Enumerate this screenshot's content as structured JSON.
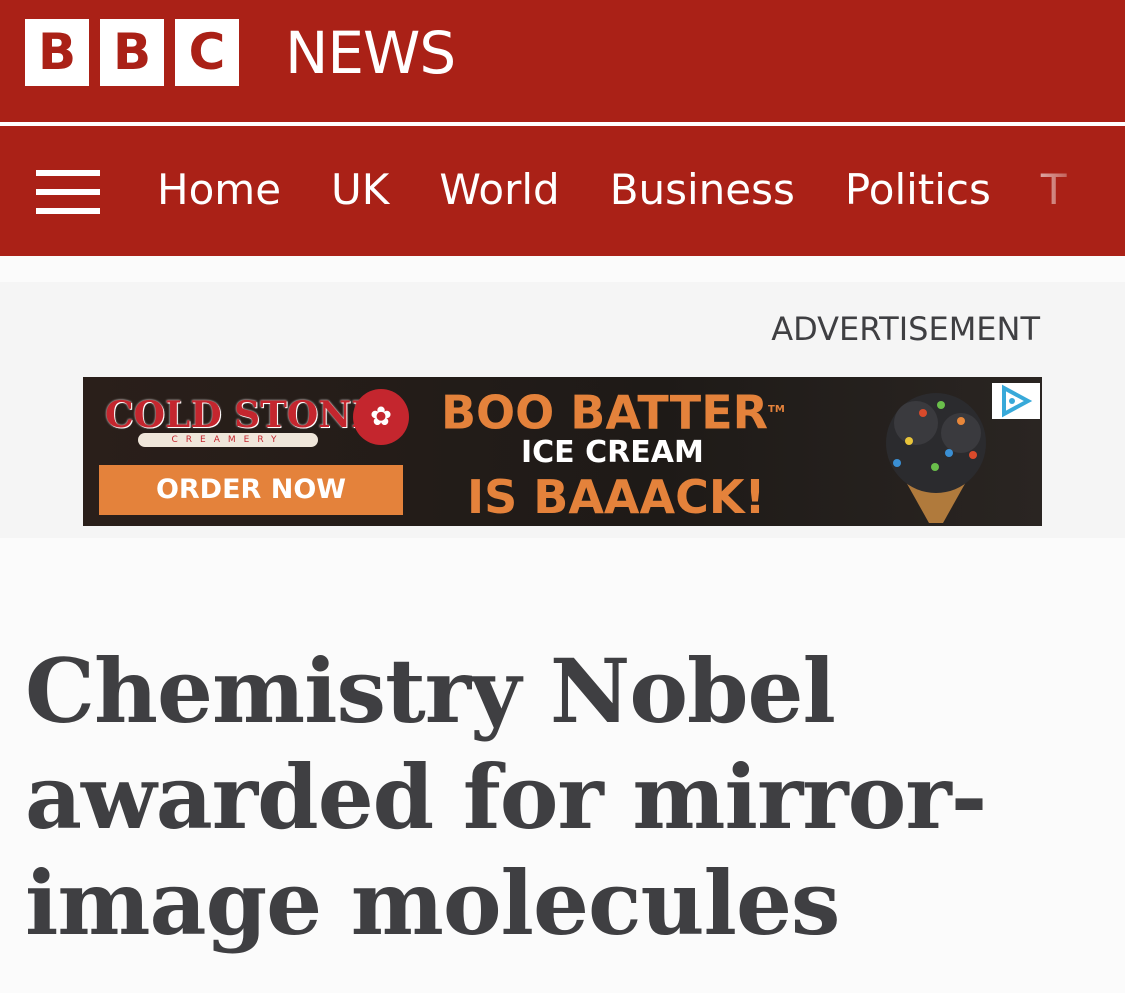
{
  "masthead": {
    "logo_letters": [
      "B",
      "B",
      "C"
    ],
    "wordmark": "NEWS",
    "brand_color": "#aa2117"
  },
  "nav": {
    "menu_icon": "hamburger-menu-icon",
    "items": [
      "Home",
      "UK",
      "World",
      "Business",
      "Politics",
      "T"
    ]
  },
  "ad": {
    "label": "ADVERTISEMENT",
    "brand": "COLD STONE",
    "brand_sub": "CREAMERY",
    "cta": "ORDER NOW",
    "line1": "BOO BATTER",
    "trademark": "TM",
    "line2": "ICE CREAM",
    "line3": "IS BAAACK!",
    "adchoices_icon": "adchoices-icon",
    "accent_color": "#e4823b"
  },
  "article": {
    "headline": "Chemistry Nobel awarded for mirror-image molecules"
  }
}
